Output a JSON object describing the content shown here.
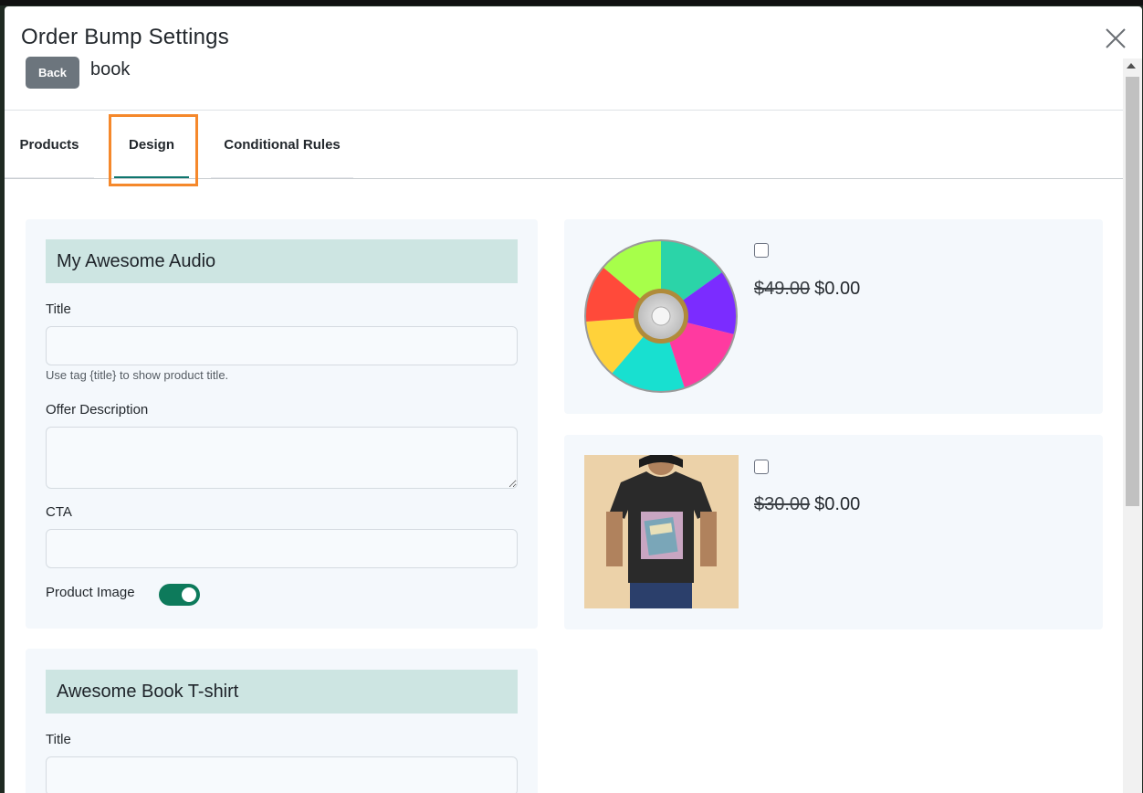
{
  "modal": {
    "title": "Order Bump Settings",
    "back_label": "Back",
    "product_name": "book"
  },
  "tabs": [
    {
      "label": "Products",
      "active": false
    },
    {
      "label": "Design",
      "active": true
    },
    {
      "label": "Conditional Rules",
      "active": false
    }
  ],
  "bumps": [
    {
      "heading": "My Awesome Audio",
      "title_label": "Title",
      "title_value": "",
      "title_help": "Use tag {title} to show product title.",
      "description_label": "Offer Description",
      "description_value": "",
      "cta_label": "CTA",
      "cta_value": "",
      "product_image_label": "Product Image",
      "product_image_enabled": true
    },
    {
      "heading": "Awesome Book T-shirt",
      "title_label": "Title",
      "title_value": ""
    }
  ],
  "previews": [
    {
      "image": "cd-disc-image",
      "checked": false,
      "old_price": "$49.00",
      "new_price": "$0.00"
    },
    {
      "image": "tshirt-image",
      "checked": false,
      "old_price": "$30.00",
      "new_price": "$0.00"
    }
  ],
  "colors": {
    "accent": "#0d7a5b",
    "highlight": "#f5882b",
    "heading_bg": "#cde5e2",
    "panel_bg": "#f4f8fc",
    "back_button": "#6c757d"
  }
}
